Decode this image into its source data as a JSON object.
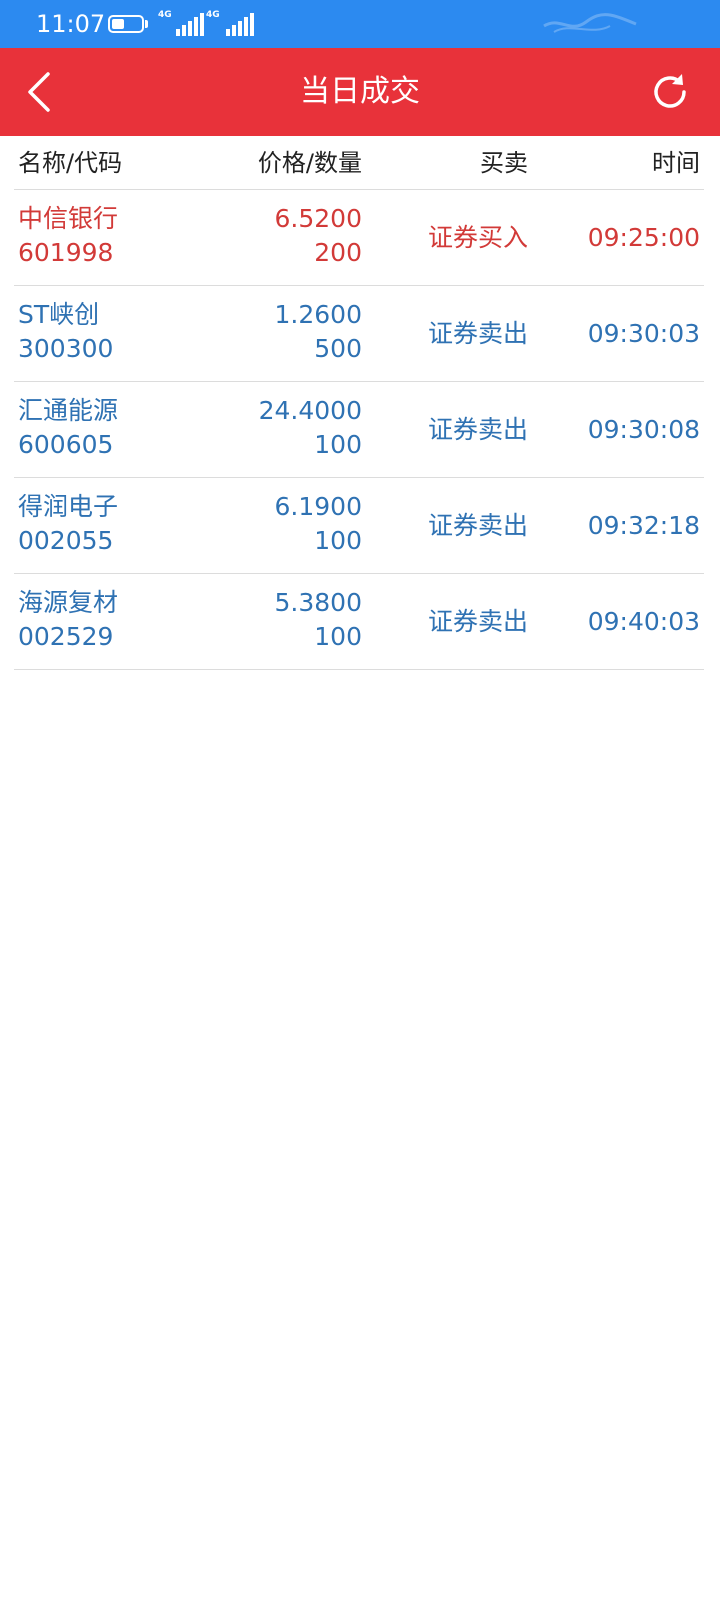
{
  "status_bar": {
    "time": "11:07",
    "network_1": "4G",
    "network_2": "4G",
    "background_color": "#2c8af0"
  },
  "header": {
    "title": "当日成交",
    "back_icon": "chevron-left-icon",
    "refresh_icon": "refresh-icon",
    "background_color": "#e8323a"
  },
  "table": {
    "columns": [
      "名称/代码",
      "价格/数量",
      "买卖",
      "时间"
    ],
    "rows": [
      {
        "name": "中信银行",
        "code": "601998",
        "price": "6.5200",
        "quantity": "200",
        "side": "证券买入",
        "time": "09:25:00",
        "type": "buy"
      },
      {
        "name": "ST峡创",
        "code": "300300",
        "price": "1.2600",
        "quantity": "500",
        "side": "证券卖出",
        "time": "09:30:03",
        "type": "sell"
      },
      {
        "name": "汇通能源",
        "code": "600605",
        "price": "24.4000",
        "quantity": "100",
        "side": "证券卖出",
        "time": "09:30:08",
        "type": "sell"
      },
      {
        "name": "得润电子",
        "code": "002055",
        "price": "6.1900",
        "quantity": "100",
        "side": "证券卖出",
        "time": "09:32:18",
        "type": "sell"
      },
      {
        "name": "海源复材",
        "code": "002529",
        "price": "5.3800",
        "quantity": "100",
        "side": "证券卖出",
        "time": "09:40:03",
        "type": "sell"
      }
    ],
    "buy_color": "#d23a38",
    "sell_color": "#2f72b3"
  }
}
